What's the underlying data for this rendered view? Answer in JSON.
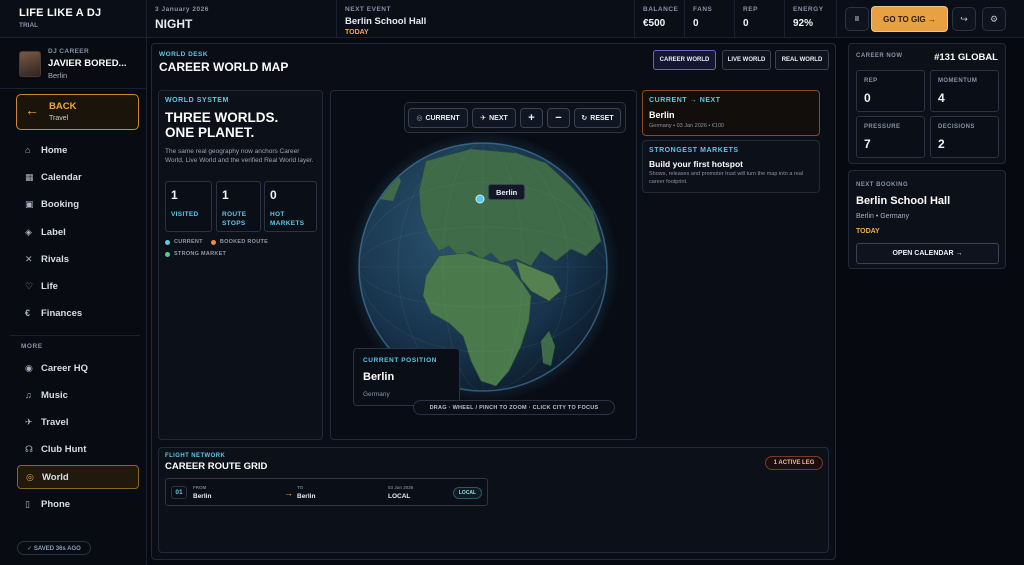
{
  "app": {
    "title": "LIFE LIKE A DJ",
    "subtitle": "TRIAL"
  },
  "topbar": {
    "date": "3 January 2026",
    "period": "NIGHT",
    "next_event_label": "NEXT EVENT",
    "next_event_venue": "Berlin School Hall",
    "next_event_when": "TODAY",
    "balance_label": "BALANCE",
    "balance": "€500",
    "fans_label": "FANS",
    "fans": "0",
    "rep_label": "REP",
    "rep": "0",
    "energy_label": "ENERGY",
    "energy": "92%",
    "pause_icon": "II",
    "go_to_gig": "GO TO GIG →"
  },
  "sidebar": {
    "profile": {
      "role": "DJ CAREER",
      "name": "JAVIER BORED...",
      "city": "Berlin"
    },
    "back": {
      "label": "BACK",
      "sub": "Travel"
    },
    "main_items": [
      {
        "label": "Home",
        "icon": "⌂"
      },
      {
        "label": "Calendar",
        "icon": "▦"
      },
      {
        "label": "Booking",
        "icon": "▣"
      },
      {
        "label": "Label",
        "icon": "◈"
      },
      {
        "label": "Rivals",
        "icon": "✕"
      },
      {
        "label": "Life",
        "icon": "♡"
      },
      {
        "label": "Finances",
        "icon": "€"
      }
    ],
    "more_label": "MORE",
    "more_items": [
      {
        "label": "Career HQ",
        "icon": "◉"
      },
      {
        "label": "Music",
        "icon": "♫"
      },
      {
        "label": "Travel",
        "icon": "✈"
      },
      {
        "label": "Club Hunt",
        "icon": "☊"
      },
      {
        "label": "World",
        "icon": "◎"
      },
      {
        "label": "Phone",
        "icon": "▯"
      }
    ],
    "saved": "✓ SAVED 36s AGO"
  },
  "world": {
    "desk_label": "WORLD DESK",
    "title": "CAREER WORLD MAP",
    "tabs": [
      "CAREER WORLD",
      "LIVE WORLD",
      "REAL WORLD"
    ],
    "system_label": "WORLD SYSTEM",
    "headline_1": "THREE WORLDS.",
    "headline_2": "ONE PLANET.",
    "description": "The same real geography now anchors Career World, Live World and the verified Real World layer.",
    "stats": [
      {
        "value": "1",
        "label": "VISITED"
      },
      {
        "value": "1",
        "label": "ROUTE STOPS"
      },
      {
        "value": "0",
        "label": "HOT MARKETS"
      }
    ],
    "legend": [
      "CURRENT",
      "BOOKED ROUTE",
      "STRONG MARKET"
    ],
    "map_controls": [
      "CURRENT",
      "NEXT",
      "+",
      "−",
      "RESET"
    ],
    "globe_city": "Berlin",
    "current_position_label": "CURRENT POSITION",
    "current_position_city": "Berlin",
    "current_position_country": "Germany",
    "map_hint": "DRAG · WHEEL / PINCH TO ZOOM · CLICK CITY TO FOCUS",
    "current_next_label": "CURRENT → NEXT",
    "current_next_city": "Berlin",
    "current_next_detail": "Germany • 03 Jan 2026 • €100",
    "markets_label": "STRONGEST MARKETS",
    "markets_title": "Build your first hotspot",
    "markets_text": "Shows, releases and promoter trust will turn the map into a real career footprint.",
    "flight_label": "FLIGHT NETWORK",
    "flight_title": "CAREER ROUTE GRID",
    "active_legs": "1 ACTIVE LEG",
    "route": {
      "index": "01",
      "from_label": "FROM",
      "from": "Berlin",
      "to_label": "TO",
      "to": "Berlin",
      "date": "03 Jan 2026",
      "type": "LOCAL",
      "badge": "LOCAL"
    }
  },
  "career": {
    "label": "CAREER NOW",
    "rank": "#131 GLOBAL",
    "stats": [
      {
        "label": "REP",
        "value": "0"
      },
      {
        "label": "MOMENTUM",
        "value": "4"
      },
      {
        "label": "PRESSURE",
        "value": "7"
      },
      {
        "label": "DECISIONS",
        "value": "2"
      }
    ],
    "next_booking_label": "NEXT BOOKING",
    "next_booking_venue": "Berlin School Hall",
    "next_booking_location": "Berlin • Germany",
    "next_booking_when": "TODAY",
    "open_calendar": "OPEN CALENDAR →"
  },
  "colors": {
    "accent": "#f0a93d",
    "cyan": "#5cc8e6",
    "ocean": "#1d3b57",
    "land": "#3f6b48"
  }
}
